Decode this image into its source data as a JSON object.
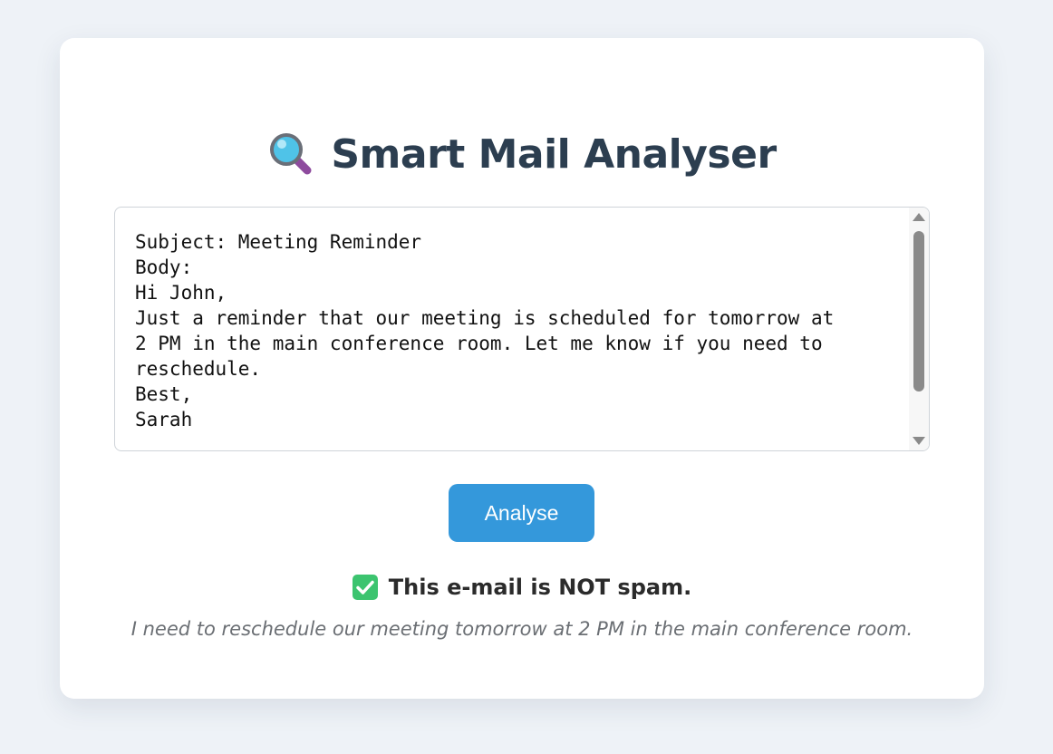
{
  "app": {
    "title": "Smart Mail Analyser",
    "title_icon": "magnifying-glass-icon"
  },
  "email": {
    "content": "Subject: Meeting Reminder\nBody:\nHi John,\nJust a reminder that our meeting is scheduled for tomorrow at\n2 PM in the main conference room. Let me know if you need to\nreschedule.\nBest,\nSarah"
  },
  "actions": {
    "analyse_label": "Analyse"
  },
  "result": {
    "icon": "check-mark-icon",
    "verdict": "This e-mail is NOT spam.",
    "summary": "I need to reschedule our meeting tomorrow at 2 PM in the main conference room."
  },
  "colors": {
    "background": "#eef2f7",
    "title": "#2c3e50",
    "button": "#3498db",
    "check": "#3cc46f"
  }
}
